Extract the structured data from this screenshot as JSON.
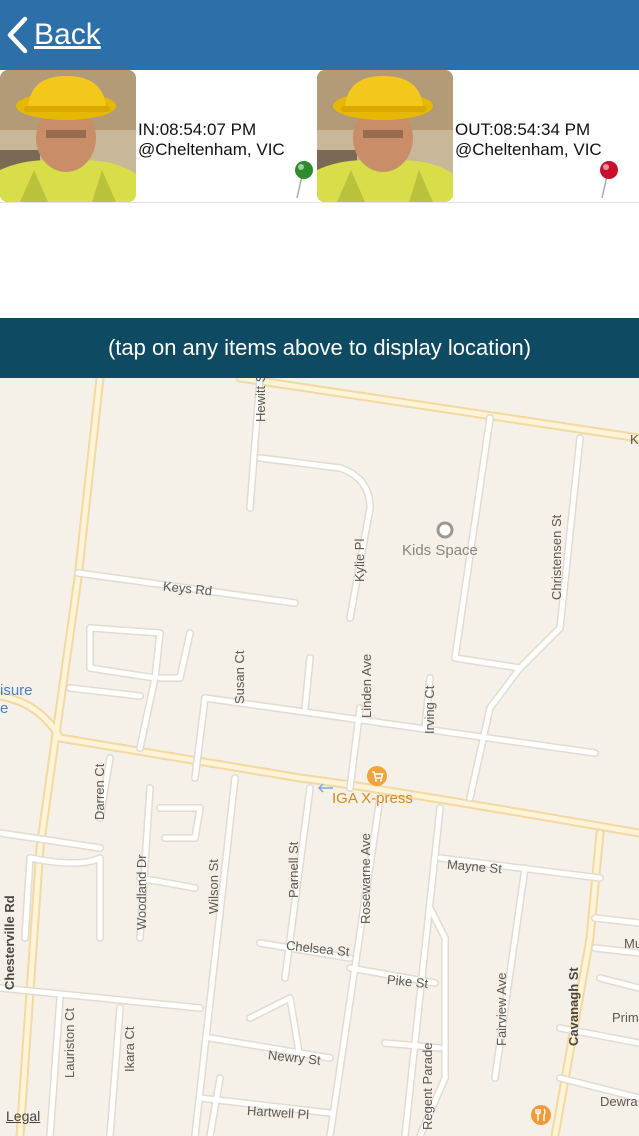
{
  "navbar": {
    "back_label": "Back"
  },
  "records": [
    {
      "time_line": "IN:08:54:07 PM",
      "location_line": "@Cheltenham, VIC",
      "pin_color": "#2e8b2e"
    },
    {
      "time_line": "OUT:08:54:34 PM",
      "location_line": "@Cheltenham, VIC",
      "pin_color": "#c8102e"
    }
  ],
  "hint": {
    "text": "(tap on any items above to display location)"
  },
  "map": {
    "streets": {
      "hewitt": "Hewitt St",
      "kylie": "Kylie Pl",
      "christensen": "Christensen St",
      "keys": "Keys Rd",
      "susan": "Susan Ct",
      "linden": "Linden Ave",
      "irving": "Irving Ct",
      "darren": "Darren Ct",
      "woodland": "Woodland Dr",
      "wilson": "Wilson St",
      "parnell": "Parnell St",
      "rosewarne": "Rosewarne Ave",
      "mayne": "Mayne St",
      "chelsea": "Chelsea St",
      "pike": "Pike St",
      "chesterville": "Chesterville Rd",
      "fairview": "Fairview Ave",
      "cavanagh": "Cavanagh St",
      "lauriston": "Lauriston Ct",
      "ikara": "Ikara Ct",
      "newry": "Newry St",
      "regent": "Regent Parade",
      "hartwell": "Hartwell Pl",
      "edge_k": "K",
      "edge_mu": "Mu",
      "edge_prim": "Prim",
      "edge_dewra": "Dewra",
      "edge_leisure_1": "isure",
      "edge_leisure_2": "e"
    },
    "pois": {
      "kids_space": "Kids Space",
      "iga": "IGA X-press"
    },
    "legal": "Legal"
  }
}
